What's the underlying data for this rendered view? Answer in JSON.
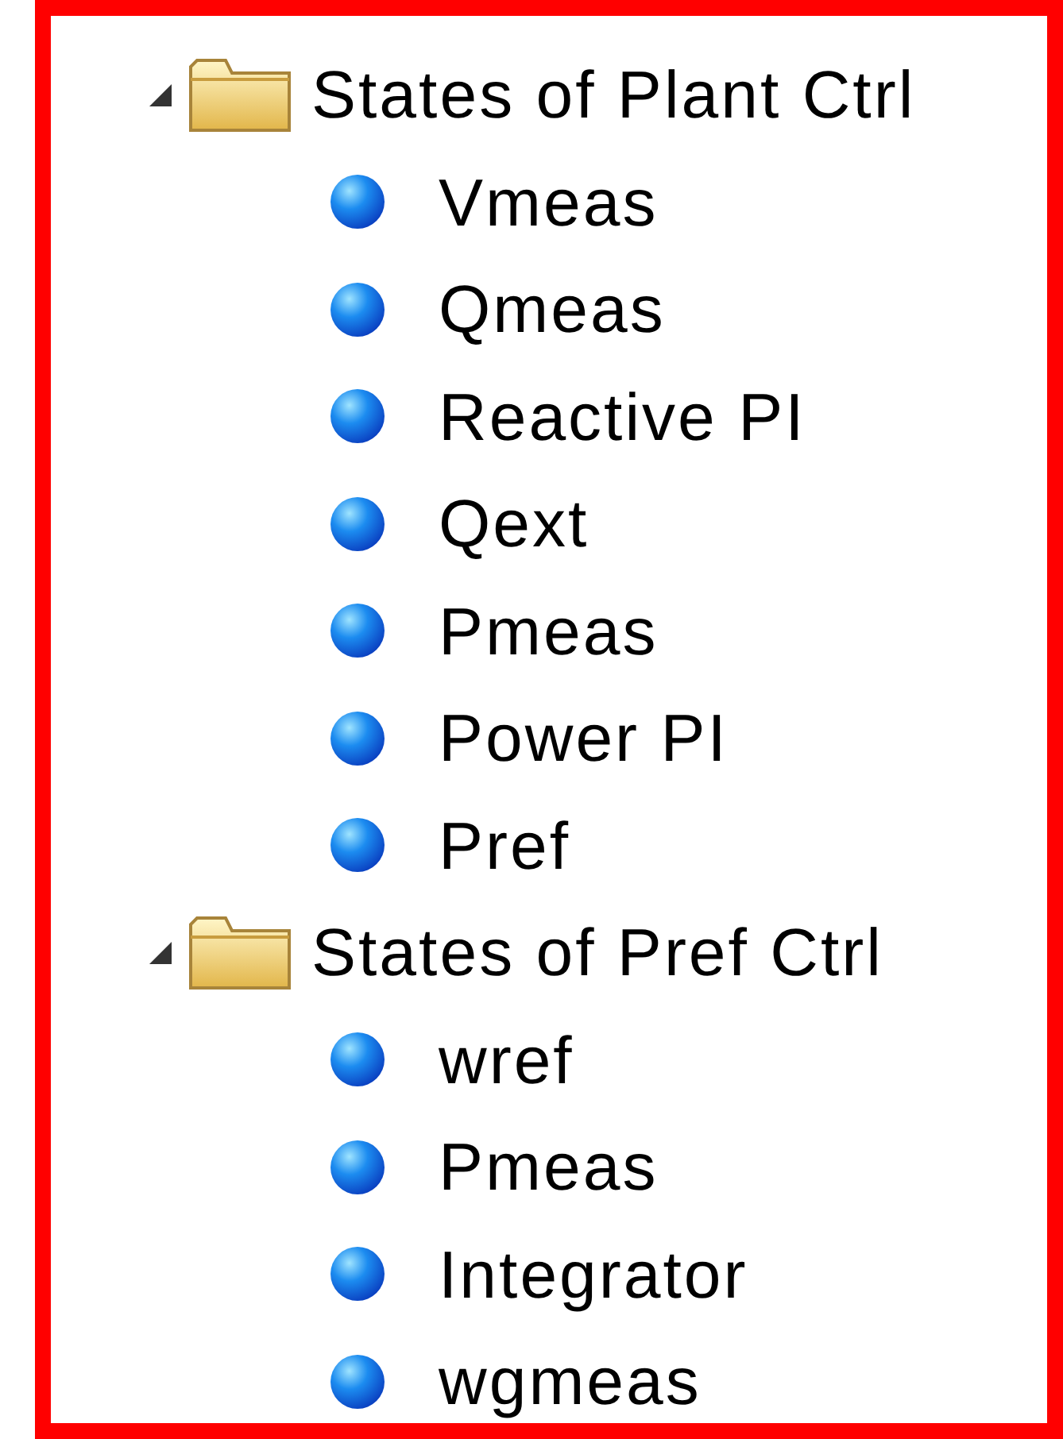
{
  "tree": [
    {
      "label": "States of Plant Ctrl",
      "expanded": true,
      "children": [
        {
          "label": "Vmeas"
        },
        {
          "label": "Qmeas"
        },
        {
          "label": "Reactive PI"
        },
        {
          "label": "Qext"
        },
        {
          "label": "Pmeas"
        },
        {
          "label": "Power PI"
        },
        {
          "label": "Pref"
        }
      ]
    },
    {
      "label": "States of Pref Ctrl",
      "expanded": true,
      "children": [
        {
          "label": "wref"
        },
        {
          "label": "Pmeas"
        },
        {
          "label": "Integrator"
        },
        {
          "label": "wgmeas"
        }
      ]
    }
  ]
}
